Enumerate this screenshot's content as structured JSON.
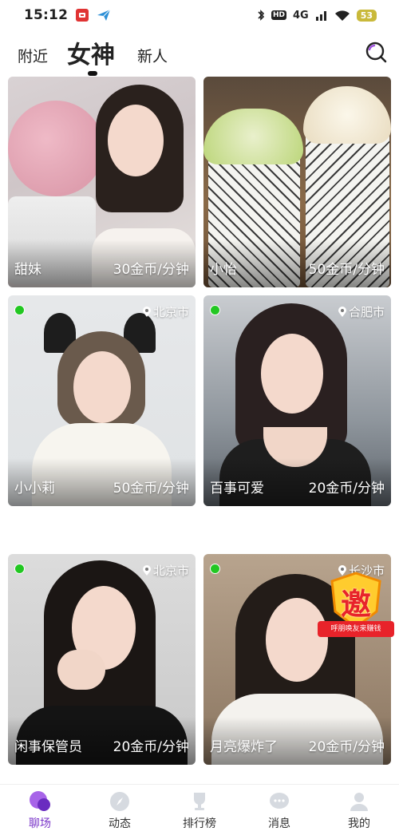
{
  "status_bar": {
    "time": "15:12",
    "network": "4G",
    "hd": "HD",
    "battery": "53"
  },
  "top_tabs": {
    "nearby": "附近",
    "goddess": "女神",
    "new": "新人"
  },
  "cards": [
    {
      "name": "甜妹",
      "price": "30金币/分钟",
      "city": "",
      "online": false
    },
    {
      "name": "小怡",
      "price": "50金币/分钟",
      "city": "",
      "online": false
    },
    {
      "name": "小小莉",
      "price": "50金币/分钟",
      "city": "北京市",
      "online": true
    },
    {
      "name": "百事可爱",
      "price": "20金币/分钟",
      "city": "合肥市",
      "online": true
    },
    {
      "name": "闲事保管员",
      "price": "20金币/分钟",
      "city": "北京市",
      "online": true
    },
    {
      "name": "月亮爆炸了",
      "price": "20金币/分钟",
      "city": "长沙市",
      "online": true
    }
  ],
  "promo": {
    "char": "邀",
    "text": "呼朋唤友来赚钱"
  },
  "bottom_nav": [
    {
      "label": "聊场",
      "icon": "chat-bubbles-icon",
      "active": true
    },
    {
      "label": "动态",
      "icon": "compass-icon",
      "active": false
    },
    {
      "label": "排行榜",
      "icon": "trophy-icon",
      "active": false
    },
    {
      "label": "消息",
      "icon": "message-icon",
      "active": false
    },
    {
      "label": "我的",
      "icon": "profile-icon",
      "active": false
    }
  ],
  "colors": {
    "accent": "#7a35c9",
    "online": "#22c722",
    "promo_red": "#e8232a"
  }
}
